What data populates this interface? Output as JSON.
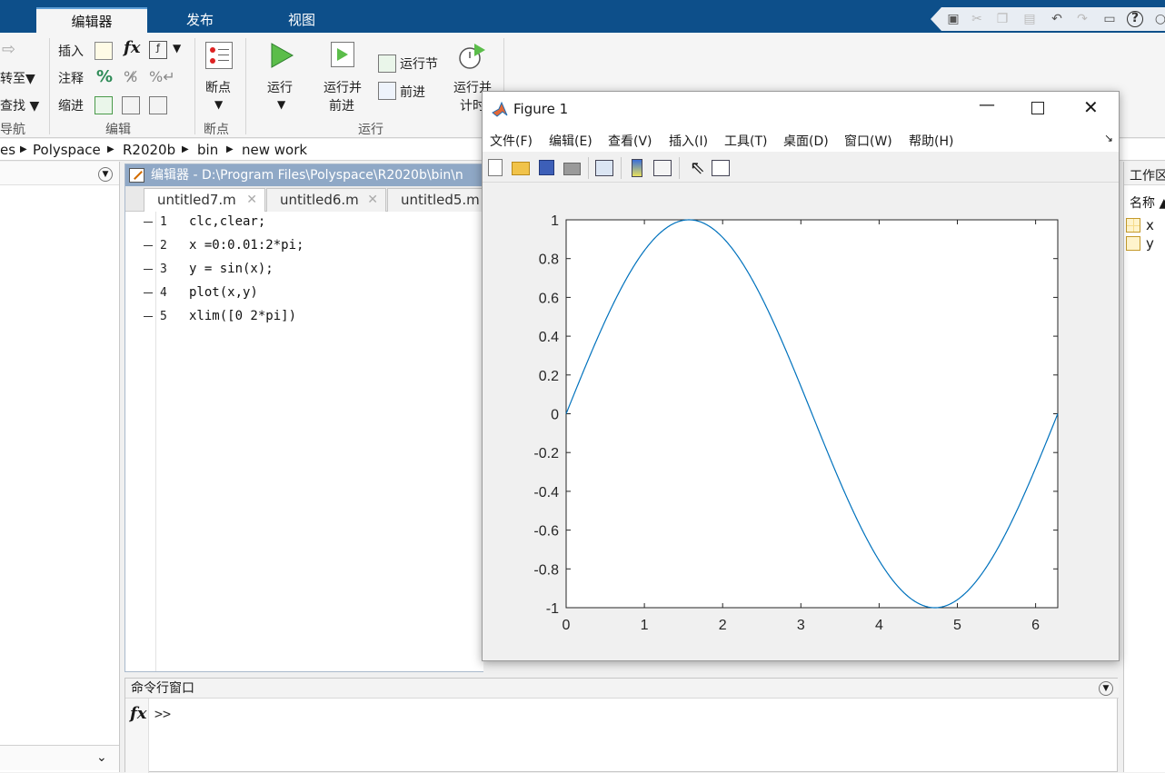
{
  "tabs": {
    "editor": "编辑器",
    "publish": "发布",
    "view": "视图"
  },
  "ribbon": {
    "goto": "转至▼",
    "find": "查找 ▼",
    "nav_section": "导航",
    "insert": "插入",
    "comment": "注释",
    "indent": "缩进",
    "fx": "fx",
    "comment_sym": "%",
    "edit_section": "编辑",
    "breakpoints": "断点",
    "breakpoints_section": "断点",
    "run": "运行",
    "run_advance_1": "运行并",
    "run_advance_2": "前进",
    "run_section_btn": "运行节",
    "advance": "前进",
    "run_time_1": "运行并",
    "run_time_2": "计时",
    "run_section": "运行"
  },
  "path": [
    "es",
    "Polyspace",
    "R2020b",
    "bin",
    "new work"
  ],
  "editor": {
    "title": "编辑器 - D:\\Program Files\\Polyspace\\R2020b\\bin\\n",
    "tabs": [
      "untitled7.m",
      "untitled6.m",
      "untitled5.m"
    ],
    "lines": [
      "clc,clear;",
      "x =0:0.01:2*pi;",
      "y = sin(x);",
      "plot(x,y)",
      "xlim([0 2*pi])"
    ],
    "line_numbers": [
      "1",
      "2",
      "3",
      "4",
      "5"
    ]
  },
  "command_window": {
    "title": "命令行窗口",
    "prompt": ">>",
    "fx": "fx"
  },
  "workspace": {
    "title": "工作区",
    "name_header": "名称 ▲",
    "vars": [
      "x",
      "y"
    ]
  },
  "figure": {
    "title": "Figure 1",
    "menu": [
      "文件(F)",
      "编辑(E)",
      "查看(V)",
      "插入(I)",
      "工具(T)",
      "桌面(D)",
      "窗口(W)",
      "帮助(H)"
    ]
  },
  "colors": {
    "brand": "#0d4f8a",
    "plot_line": "#0072bd",
    "editor_title": "#8fa8c6"
  },
  "chart_data": {
    "type": "line",
    "function": "y = sin(x)",
    "series": [
      {
        "x_start": 0,
        "x_end": 6.2832,
        "x_step": 0.01,
        "description_expr": "sin(x)"
      }
    ],
    "xlim": [
      0,
      6.2832
    ],
    "ylim": [
      -1,
      1
    ],
    "xticks": [
      "0",
      "1",
      "2",
      "3",
      "4",
      "5",
      "6"
    ],
    "yticks": [
      "-1",
      "-0.8",
      "-0.6",
      "-0.4",
      "-0.2",
      "0",
      "0.2",
      "0.4",
      "0.6",
      "0.8",
      "1"
    ],
    "grid": false
  }
}
